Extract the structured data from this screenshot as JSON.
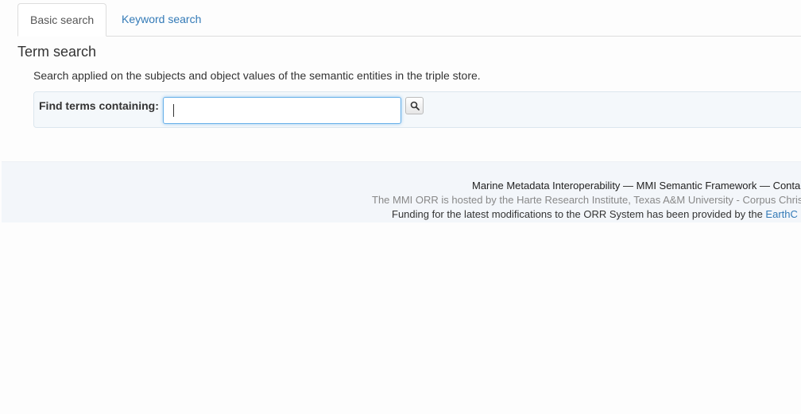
{
  "tabs": {
    "basic": "Basic search",
    "keyword": "Keyword search"
  },
  "term_search": {
    "title": "Term search",
    "description": "Search applied on the subjects and object values of the semantic entities in the triple store.",
    "find_label": "Find terms containing:",
    "input_value": "",
    "button_icon": "search-icon"
  },
  "footer": {
    "line1": "Marine Metadata Interoperability — MMI Semantic Framework — Conta",
    "line2": "The MMI ORR is hosted by the Harte Research Institute, Texas A&M University - Corpus Chris",
    "line3_prefix": "Funding for the latest modifications to the ORR System has been provided by the ",
    "line3_link": "EarthC"
  },
  "colors": {
    "link": "#337ab7",
    "panel_bg": "#f4f8fb",
    "footer_bg": "#f3f6fa"
  }
}
